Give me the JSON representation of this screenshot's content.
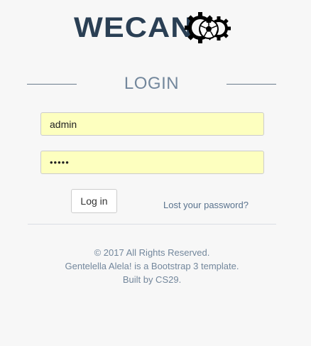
{
  "brand": {
    "logo_text": "WECAN"
  },
  "login": {
    "heading": "LOGIN",
    "username_value": "admin",
    "password_value": "•••••",
    "login_button": "Log in",
    "lost_password_link": "Lost your password?"
  },
  "footer": {
    "line1": "© 2017 All Rights Reserved.",
    "line2": "Gentelella Alela! is a Bootstrap 3 template.",
    "line3": "Built by CS29."
  },
  "colors": {
    "background": "#f7f7f7",
    "text": "#73879c",
    "logo": "#2a3f54",
    "autofill": "#fdffbf"
  },
  "icons": {
    "logo_icon": "soccer-ball-gears-icon"
  }
}
